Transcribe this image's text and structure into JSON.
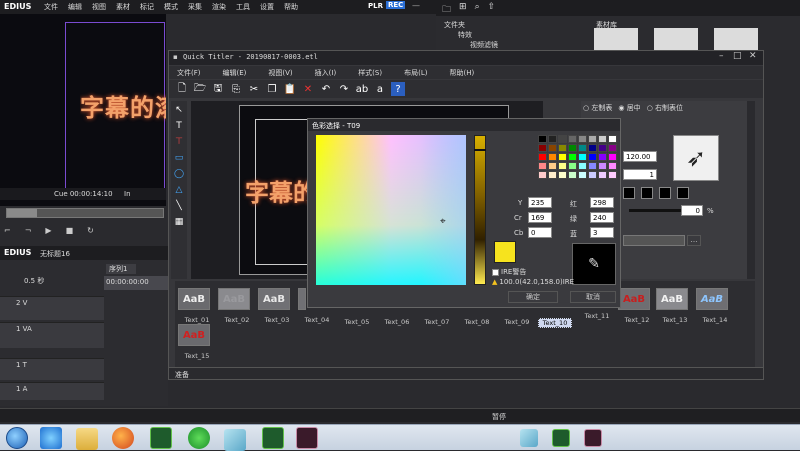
{
  "edius": {
    "title": "EDIUS",
    "menu": [
      "文件",
      "编辑",
      "视图",
      "素材",
      "标记",
      "模式",
      "采集",
      "渲染",
      "工具",
      "设置",
      "帮助"
    ],
    "plr": "PLR",
    "rec": "REC",
    "preview_text": "字幕的滚",
    "cue": "Cue 00:00:14:10",
    "in_label": "In",
    "timeline_title": "EDIUS",
    "timeline_project": "无标题16",
    "seq_tab": "序列1",
    "zoom": "0.5 秒",
    "timecode": "00:00:00:00",
    "tracks": [
      "2 V",
      "1 VA",
      "1 T",
      "1 A"
    ],
    "status_left": "准备",
    "status_mid": "暂停"
  },
  "bin": {
    "title": "文件夹",
    "tree": [
      "特效",
      "视频滤镜"
    ],
    "panel_title": "素材库"
  },
  "quick_titler": {
    "title": "Quick Titler - 20190817-0003.etl",
    "menu": [
      "文件(F)",
      "编辑(E)",
      "视图(V)",
      "插入(I)",
      "样式(S)",
      "布局(L)",
      "帮助(H)"
    ],
    "canvas_text": "字幕的",
    "radio": [
      "左制表",
      "居中",
      "右制表位"
    ],
    "size_value": "120.00",
    "spin_value": "1",
    "percent_value": "0",
    "percent_unit": "%",
    "styles": [
      "Text_01",
      "Text_02",
      "Text_03",
      "Text_04",
      "Text_05",
      "Text_06",
      "Text_07",
      "Text_08",
      "Text_09",
      "Text_10",
      "Text_11",
      "Text_12",
      "Text_13",
      "Text_14",
      "Text_15"
    ],
    "selected_style": "Text_10",
    "thumb_text": "AaB",
    "status": "准备"
  },
  "color_picker": {
    "title": "色彩选择 - T09",
    "y_label": "Y",
    "y_value": "235",
    "cr_label": "Cr",
    "cr_value": "169",
    "cb_label": "Cb",
    "cb_value": "0",
    "red_label": "红",
    "red_value": "298",
    "green_label": "绿",
    "green_value": "240",
    "blue_label": "蓝",
    "blue_value": "3",
    "ire_warning": "IRE警告",
    "ire_value": "100.0(42.0,158.0)IRE",
    "ok": "确定",
    "cancel": "取消",
    "current_color": "#f6e31e"
  },
  "taskbar": {
    "icons": [
      "start-orb",
      "ie-icon",
      "folder-icon",
      "firefox-icon",
      "green-app-icon",
      "green-circle-icon",
      "tablet-icon",
      "media-icon",
      "film-icon"
    ]
  }
}
